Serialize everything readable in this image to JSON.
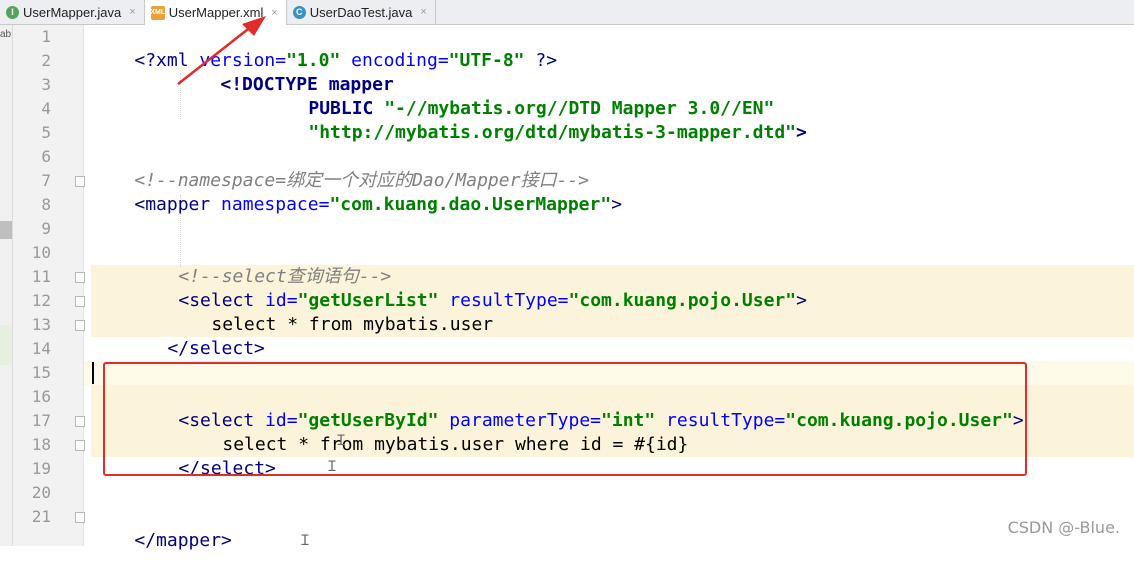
{
  "tabs": [
    {
      "icon": "I",
      "label": "UserMapper.java",
      "close": "×"
    },
    {
      "icon": "XML",
      "label": "UserMapper.xml",
      "close": "×"
    },
    {
      "icon": "C",
      "label": "UserDaoTest.java",
      "close": "×"
    }
  ],
  "left_strip_label": "ab",
  "line_numbers": [
    "1",
    "2",
    "3",
    "4",
    "5",
    "6",
    "7",
    "8",
    "9",
    "10",
    "11",
    "12",
    "13",
    "14",
    "15",
    "16",
    "17",
    "18",
    "19",
    "20",
    "21"
  ],
  "code": {
    "l1": {
      "a": "<?xml",
      "b": " version=",
      "c": "\"1.0\"",
      "d": " encoding=",
      "e": "\"UTF-8\"",
      "f": " ?>"
    },
    "l2": {
      "a": "<!DOCTYPE mapper"
    },
    "l3": {
      "a": "PUBLIC ",
      "b": "\"-//mybatis.org//DTD Mapper 3.0//EN\""
    },
    "l4": {
      "a": "\"http://mybatis.org/dtd/mybatis-3-mapper.dtd\"",
      "b": ">"
    },
    "l6": {
      "a": "<!--namespace=绑定一个对应的Dao/Mapper接口-->"
    },
    "l7": {
      "a": "<mapper",
      "b": " namespace=",
      "c": "\"com.kuang.dao.UserMapper\"",
      "d": ">"
    },
    "l10": {
      "a": "<!--select查询语句-->"
    },
    "l11": {
      "a": "<select",
      "b": " id=",
      "c": "\"getUserList\"",
      "d": " resultType=",
      "e": "\"com.kuang.pojo.User\"",
      "f": ">"
    },
    "l12": {
      "a": "select * from mybatis.user"
    },
    "l13": {
      "a": "</select>"
    },
    "l16": {
      "a": "<select",
      "b": " id=",
      "c": "\"getUserById\"",
      "d": " parameterType=",
      "e": "\"int\"",
      "f": " resultType=",
      "g": "\"com.kuang.pojo.User\"",
      "h": ">"
    },
    "l17": {
      "a": "select * from mybatis.user where id = #{id}"
    },
    "l18": {
      "a": "</select>"
    },
    "l21": {
      "a": "</mapper>"
    }
  },
  "watermark": "CSDN @-Blue.",
  "colors": {
    "annotation_red": "#e32b2b",
    "highlight": "#fbf4db"
  }
}
